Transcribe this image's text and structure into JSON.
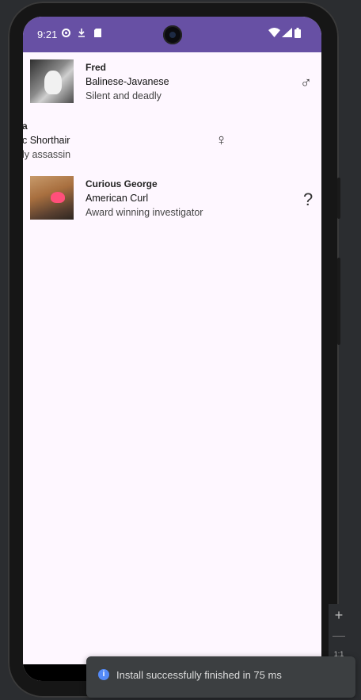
{
  "status_bar": {
    "time": "9:21",
    "left_icons": [
      "settings-icon",
      "download-icon",
      "sd-card-icon"
    ],
    "right_icons": [
      "wifi-icon",
      "signal-icon",
      "battery-icon"
    ],
    "background": "#6750a4"
  },
  "cats": [
    {
      "name": "Fred",
      "breed": "Balinese-Javanese",
      "description": "Silent and deadly",
      "gender_symbol": "♂",
      "image": "black-and-white-kitten"
    },
    {
      "name": "a",
      "breed": "c Shorthair",
      "description": "ly assassin",
      "gender_symbol": "♀",
      "image": "none"
    },
    {
      "name": "Curious George",
      "breed": "American Curl",
      "description": "Award winning investigator",
      "gender_symbol": "?",
      "image": "orange-kitten-with-heart"
    }
  ],
  "emulator": {
    "zoom_in_label": "+",
    "zoom_ratio_label": "1:1"
  },
  "toast": {
    "message": "Install successfully finished in 75 ms",
    "icon": "info-icon",
    "icon_glyph": "i",
    "accent": "#548af7"
  },
  "colors": {
    "screen_background": "#fef7ff",
    "ide_background": "#2b2d30"
  }
}
